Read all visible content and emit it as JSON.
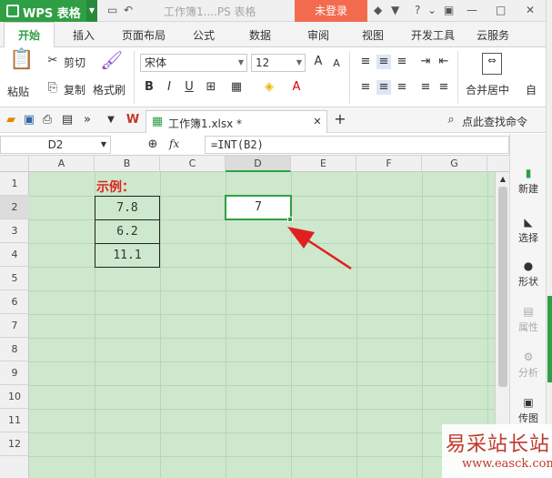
{
  "titlebar": {
    "app_name": "WPS 表格",
    "doc_title": "工作簿1....PS 表格",
    "login_label": "未登录",
    "colors": {
      "app": "#2f9f45",
      "login": "#f26b4f"
    }
  },
  "tabs": [
    "开始",
    "插入",
    "页面布局",
    "公式",
    "数据",
    "审阅",
    "视图",
    "开发工具",
    "云服务"
  ],
  "ribbon": {
    "paste": "粘贴",
    "cut": "剪切",
    "copy": "复制",
    "format_painter": "格式刷",
    "font_name": "宋体",
    "font_size": "12",
    "merge_center": "合并居中",
    "auto": "自"
  },
  "qbar": {
    "doc_tab": "工作簿1.xlsx *",
    "search": "点此查找命令"
  },
  "formula_bar": {
    "name_box": "D2",
    "fx": "fx",
    "formula": "=INT(B2)"
  },
  "grid": {
    "columns": [
      "A",
      "B",
      "C",
      "D",
      "E",
      "F",
      "G"
    ],
    "rows": [
      "1",
      "2",
      "3",
      "4",
      "5",
      "6",
      "7",
      "8",
      "9",
      "10",
      "11",
      "12"
    ],
    "example_label": "示例：",
    "b_values": [
      "7.8",
      "6.2",
      "11.1"
    ],
    "d2_value": "7"
  },
  "side_panel": [
    "新建",
    "选择",
    "形状",
    "属性",
    "分析",
    "传图"
  ],
  "watermark": {
    "title": "易采站长站",
    "url": "www.easck.com"
  }
}
